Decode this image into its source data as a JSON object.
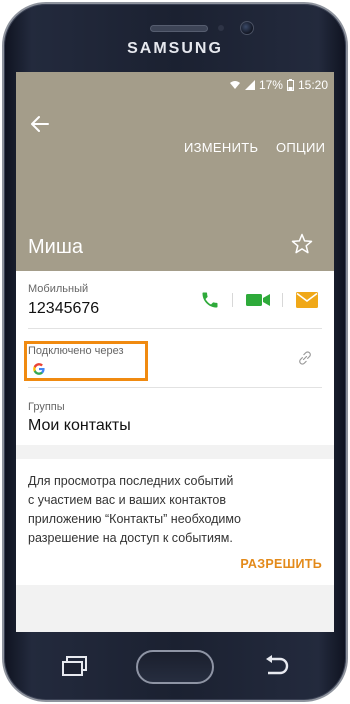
{
  "device": {
    "brand": "SAMSUNG"
  },
  "status_bar": {
    "battery": "17%",
    "time": "15:20"
  },
  "header": {
    "edit_label": "ИЗМЕНИТЬ",
    "options_label": "ОПЦИИ",
    "contact_name": "Миша"
  },
  "phone_field": {
    "label": "Мобильный",
    "value": "12345676"
  },
  "connected": {
    "label": "Подключено через"
  },
  "groups": {
    "label": "Группы",
    "value": "Мои контакты"
  },
  "permission": {
    "lines": [
      "Для просмотра последних событий",
      "с участием вас и ваших контактов",
      "приложению “Контакты” необходимо",
      "разрешение на доступ к событиям."
    ],
    "allow_label": "РАЗРЕШИТЬ"
  },
  "colors": {
    "header_bg": "#a49d8a",
    "call_green": "#2eaa3a",
    "video_green": "#2eaa3a",
    "message_orange": "#f0a818",
    "highlight_orange": "#f08a10",
    "allow_orange": "#e38a1a"
  },
  "icons": [
    "back-arrow-icon",
    "star-icon",
    "phone-icon",
    "video-call-icon",
    "envelope-icon",
    "google-icon",
    "link-icon",
    "wifi-icon",
    "signal-icon",
    "battery-icon"
  ]
}
